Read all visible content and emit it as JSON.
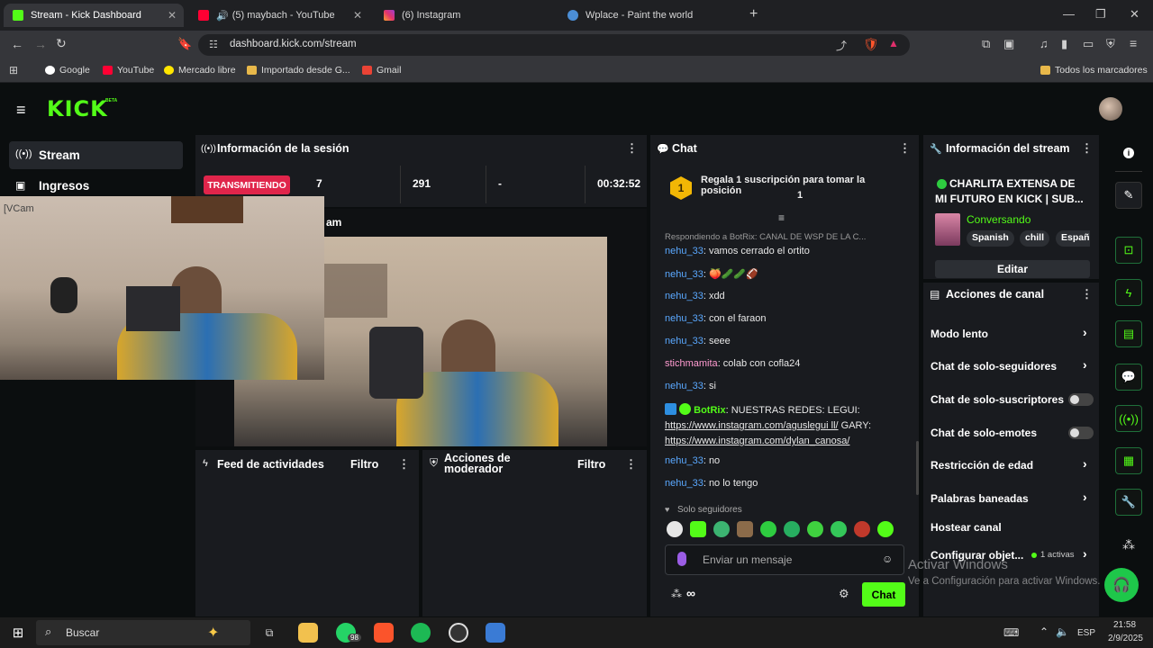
{
  "browser": {
    "tabs": [
      {
        "title": "Stream - Kick Dashboard"
      },
      {
        "title": "(5) maybach - YouTube"
      },
      {
        "title": "(6) Instagram"
      },
      {
        "title": "Wplace - Paint the world"
      }
    ],
    "url": "dashboard.kick.com/stream",
    "bookmarks": [
      "Google",
      "YouTube",
      "Mercado libre",
      "Importado desde G...",
      "Gmail"
    ],
    "all_bookmarks": "Todos los marcadores"
  },
  "kick": {
    "logo": "KICK",
    "beta": "BETA",
    "nav": [
      "Stream",
      "Ingresos"
    ],
    "session": {
      "title": "Información de la sesión",
      "status": "TRANSMITIENDO",
      "viewers": "7",
      "followers": "291",
      "dash": "-",
      "duration": "00:32:52",
      "cam_label": "[VCam",
      "preview_label": "am"
    },
    "activity": {
      "title": "Feed de actividades",
      "filter": "Filtro"
    },
    "mod": {
      "title": "Acciones de moderador",
      "filter": "Filtro"
    },
    "chat": {
      "title": "Chat",
      "gift_text": "Regala 1 suscripción para tomar la posición",
      "gift_pos": "1",
      "gift_badge": "1",
      "reply": "Respondiendo a BotRix: CANAL DE WSP DE LA C...",
      "messages": [
        {
          "user": "nehu_33",
          "text": ": vamos cerrado el ortito"
        },
        {
          "user": "nehu_33",
          "text": ": 🍑🥒🥒🏈"
        },
        {
          "user": "nehu_33",
          "text": ": xdd"
        },
        {
          "user": "nehu_33",
          "text": ": con el faraon"
        },
        {
          "user": "nehu_33",
          "text": ": seee"
        },
        {
          "user": "stichmamita",
          "text": ": colab con cofla24"
        },
        {
          "user": "nehu_33",
          "text": ": si"
        }
      ],
      "bot_user": "BotRix",
      "bot_text": ": NUESTRAS REDES: LEGUI:",
      "bot_link1": "https://www.instagram.com/aguslegui ll/",
      "bot_gary": " GARY:",
      "bot_link2": "https://www.instagram.com/dylan_canosa/",
      "messages2": [
        {
          "user": "nehu_33",
          "text": ": no"
        },
        {
          "user": "nehu_33",
          "text": ": no lo tengo"
        }
      ],
      "followers_only": "Solo seguidores",
      "placeholder": "Enviar un mensaje",
      "infinity": "∞",
      "send": "Chat"
    },
    "stream_info": {
      "title": "Información del stream",
      "stream_title_line1": "CHARLITA EXTENSA DE",
      "stream_title_line2": "MI FUTURO EN KICK | SUB...",
      "category": "Conversando",
      "tags": [
        "Spanish",
        "chill",
        "Españ"
      ],
      "edit": "Editar"
    },
    "channel_actions": {
      "title": "Acciones de canal",
      "items": [
        "Modo lento",
        "Chat de solo-seguidores",
        "Chat de solo-suscriptores",
        "Chat de solo-emotes",
        "Restricción de edad",
        "Palabras baneadas",
        "Hostear canal",
        "Configurar objet..."
      ],
      "active": "1 activas"
    },
    "colors": {
      "brand": "#53fc18",
      "live": "#e0254b",
      "bg": "#0b0e0f",
      "panel": "#191b1f"
    }
  },
  "watermark": {
    "line1": "Activar Windows",
    "line2": "Ve a Configuración para activar Windows."
  },
  "taskbar": {
    "search": "Buscar",
    "badge": "98",
    "time": "21:58",
    "date": "2/9/2025",
    "lang": "ESP"
  }
}
